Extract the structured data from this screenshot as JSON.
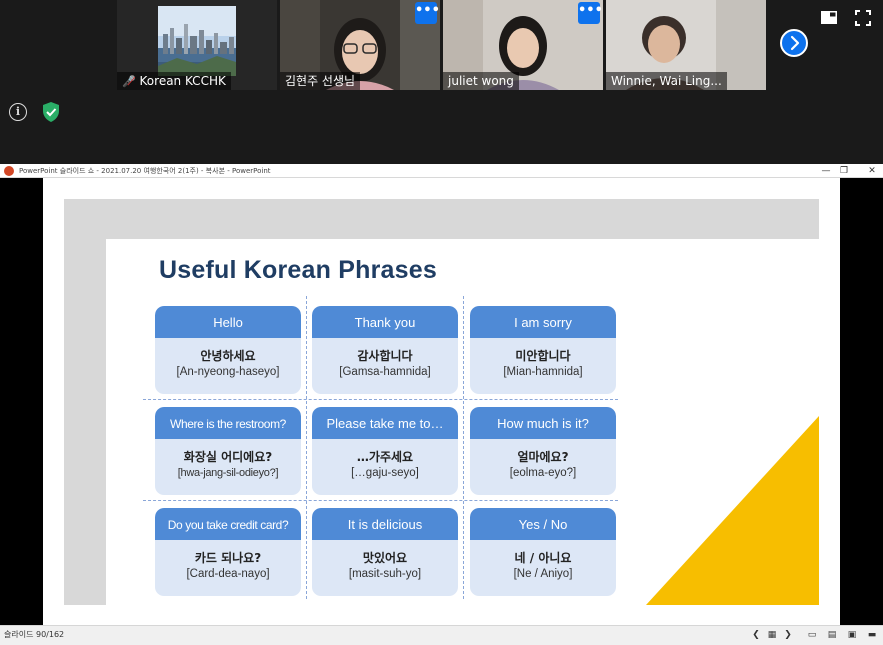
{
  "zoom": {
    "participants": [
      {
        "name": "Korean KCCHK",
        "muted": true
      },
      {
        "name": "김현주 선생님",
        "active_speaker": true
      },
      {
        "name": "juliet wong"
      },
      {
        "name": "Winnie, Wai Ling..."
      }
    ],
    "more_label": "•••",
    "info_icon": "i",
    "colors": {
      "active_border": "#8ed23f",
      "accent": "#0e72ed",
      "shield": "#2aae67"
    }
  },
  "ppt": {
    "window_title": "PowerPoint 슬라이드 쇼  -  2021.07.20 여행한국어 2(1주) - 복사본 - PowerPoint",
    "status_text": "슬라이드 90/162",
    "window_controls": {
      "minimize": "—",
      "restore": "❐",
      "close": "✕"
    }
  },
  "slide": {
    "title": "Useful Korean Phrases",
    "colors": {
      "card_head": "#4f8ad6",
      "card_body": "#dde7f6",
      "title": "#1f3d63",
      "accent_triangle": "#f7be00"
    },
    "cards": [
      {
        "en": "Hello",
        "ko": "안녕하세요",
        "rom": "[An-nyeong-haseyo]"
      },
      {
        "en": "Thank you",
        "ko": "감사합니다",
        "rom": "[Gamsa-hamnida]"
      },
      {
        "en": "I am sorry",
        "ko": "미안합니다",
        "rom": "[Mian-hamnida]"
      },
      {
        "en": "Where is the restroom?",
        "ko": "화장실 어디에요?",
        "rom": "[hwa-jang-sil-odieyo?]"
      },
      {
        "en": "Please take me to…",
        "ko": "…가주세요",
        "rom": "[…gaju-seyo]"
      },
      {
        "en": "How much is it?",
        "ko": "얼마에요?",
        "rom": "[eolma-eyo?]"
      },
      {
        "en": "Do you take credit card?",
        "ko": "카드 되나요?",
        "rom": "[Card-dea-nayo]"
      },
      {
        "en": "It is delicious",
        "ko": "맛있어요",
        "rom": "[masit-suh-yo]"
      },
      {
        "en": "Yes / No",
        "ko": "네 / 아니요",
        "rom": "[Ne / Aniyo]"
      }
    ]
  }
}
